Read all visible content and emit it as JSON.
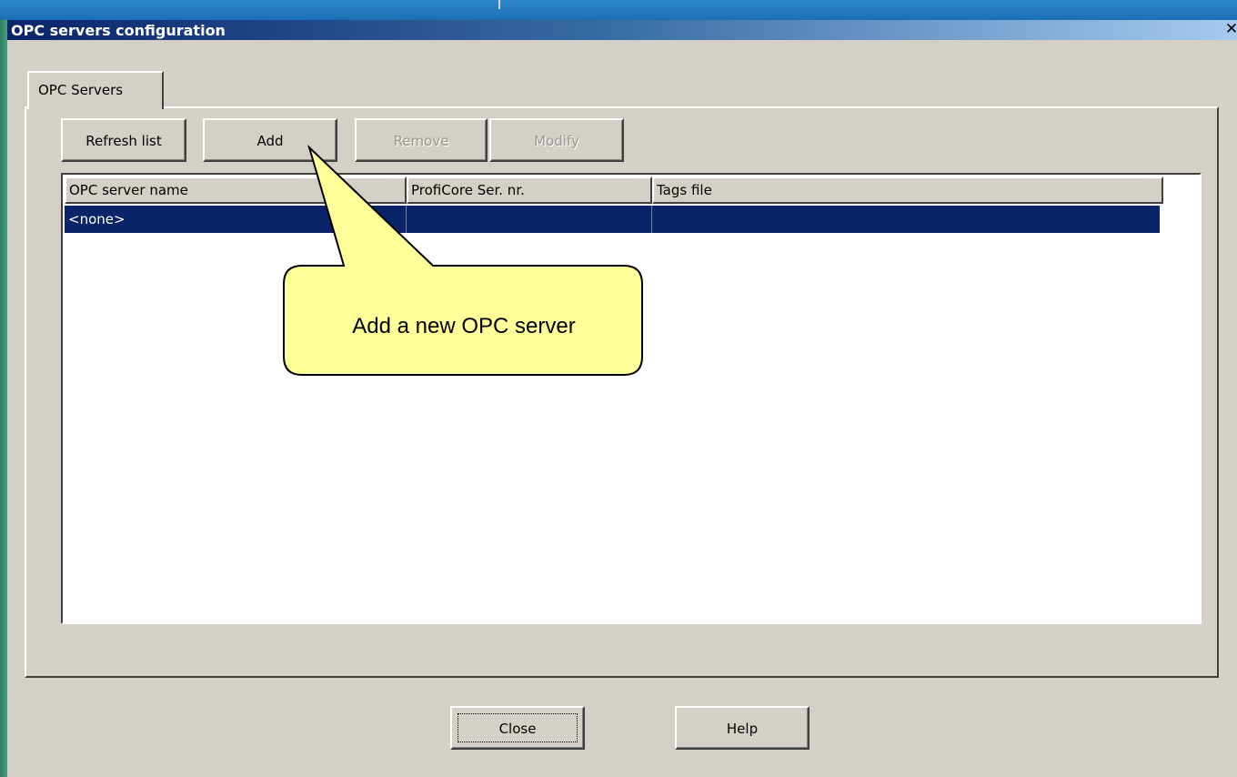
{
  "window": {
    "title": "OPC servers configuration",
    "close_glyph": "✕"
  },
  "tabs": [
    {
      "label": "OPC Servers",
      "active": true
    }
  ],
  "toolbar": {
    "refresh_label": "Refresh list",
    "add_label": "Add",
    "remove_label": "Remove",
    "modify_label": "Modify"
  },
  "list": {
    "columns": [
      "OPC server name",
      "ProfiCore Ser. nr.",
      "Tags file"
    ],
    "rows": [
      [
        "<none>",
        "",
        ""
      ]
    ]
  },
  "callout": {
    "text": "Add a new OPC server"
  },
  "footer": {
    "close_label": "Close",
    "help_label": "Help"
  },
  "colors": {
    "selection": "#0a246a",
    "callout_fill": "#ffff99",
    "dialog_bg": "#d4d0c8"
  }
}
